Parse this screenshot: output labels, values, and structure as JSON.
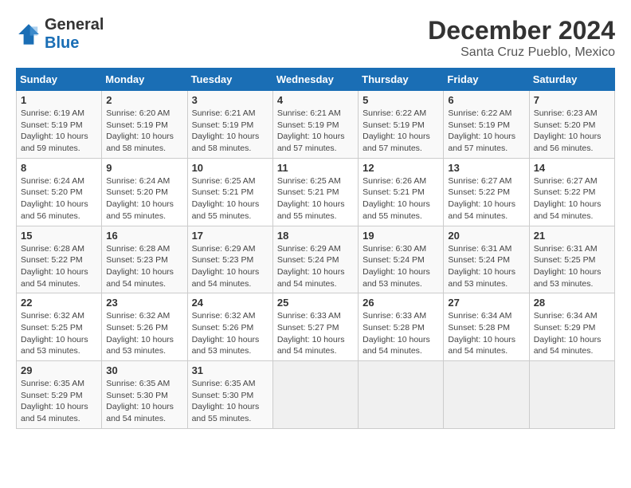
{
  "logo": {
    "line1": "General",
    "line2": "Blue"
  },
  "title": "December 2024",
  "location": "Santa Cruz Pueblo, Mexico",
  "headers": [
    "Sunday",
    "Monday",
    "Tuesday",
    "Wednesday",
    "Thursday",
    "Friday",
    "Saturday"
  ],
  "weeks": [
    [
      {
        "day": "1",
        "info": "Sunrise: 6:19 AM\nSunset: 5:19 PM\nDaylight: 10 hours\nand 59 minutes."
      },
      {
        "day": "2",
        "info": "Sunrise: 6:20 AM\nSunset: 5:19 PM\nDaylight: 10 hours\nand 58 minutes."
      },
      {
        "day": "3",
        "info": "Sunrise: 6:21 AM\nSunset: 5:19 PM\nDaylight: 10 hours\nand 58 minutes."
      },
      {
        "day": "4",
        "info": "Sunrise: 6:21 AM\nSunset: 5:19 PM\nDaylight: 10 hours\nand 57 minutes."
      },
      {
        "day": "5",
        "info": "Sunrise: 6:22 AM\nSunset: 5:19 PM\nDaylight: 10 hours\nand 57 minutes."
      },
      {
        "day": "6",
        "info": "Sunrise: 6:22 AM\nSunset: 5:19 PM\nDaylight: 10 hours\nand 57 minutes."
      },
      {
        "day": "7",
        "info": "Sunrise: 6:23 AM\nSunset: 5:20 PM\nDaylight: 10 hours\nand 56 minutes."
      }
    ],
    [
      {
        "day": "8",
        "info": "Sunrise: 6:24 AM\nSunset: 5:20 PM\nDaylight: 10 hours\nand 56 minutes."
      },
      {
        "day": "9",
        "info": "Sunrise: 6:24 AM\nSunset: 5:20 PM\nDaylight: 10 hours\nand 55 minutes."
      },
      {
        "day": "10",
        "info": "Sunrise: 6:25 AM\nSunset: 5:21 PM\nDaylight: 10 hours\nand 55 minutes."
      },
      {
        "day": "11",
        "info": "Sunrise: 6:25 AM\nSunset: 5:21 PM\nDaylight: 10 hours\nand 55 minutes."
      },
      {
        "day": "12",
        "info": "Sunrise: 6:26 AM\nSunset: 5:21 PM\nDaylight: 10 hours\nand 55 minutes."
      },
      {
        "day": "13",
        "info": "Sunrise: 6:27 AM\nSunset: 5:22 PM\nDaylight: 10 hours\nand 54 minutes."
      },
      {
        "day": "14",
        "info": "Sunrise: 6:27 AM\nSunset: 5:22 PM\nDaylight: 10 hours\nand 54 minutes."
      }
    ],
    [
      {
        "day": "15",
        "info": "Sunrise: 6:28 AM\nSunset: 5:22 PM\nDaylight: 10 hours\nand 54 minutes."
      },
      {
        "day": "16",
        "info": "Sunrise: 6:28 AM\nSunset: 5:23 PM\nDaylight: 10 hours\nand 54 minutes."
      },
      {
        "day": "17",
        "info": "Sunrise: 6:29 AM\nSunset: 5:23 PM\nDaylight: 10 hours\nand 54 minutes."
      },
      {
        "day": "18",
        "info": "Sunrise: 6:29 AM\nSunset: 5:24 PM\nDaylight: 10 hours\nand 54 minutes."
      },
      {
        "day": "19",
        "info": "Sunrise: 6:30 AM\nSunset: 5:24 PM\nDaylight: 10 hours\nand 53 minutes."
      },
      {
        "day": "20",
        "info": "Sunrise: 6:31 AM\nSunset: 5:24 PM\nDaylight: 10 hours\nand 53 minutes."
      },
      {
        "day": "21",
        "info": "Sunrise: 6:31 AM\nSunset: 5:25 PM\nDaylight: 10 hours\nand 53 minutes."
      }
    ],
    [
      {
        "day": "22",
        "info": "Sunrise: 6:32 AM\nSunset: 5:25 PM\nDaylight: 10 hours\nand 53 minutes."
      },
      {
        "day": "23",
        "info": "Sunrise: 6:32 AM\nSunset: 5:26 PM\nDaylight: 10 hours\nand 53 minutes."
      },
      {
        "day": "24",
        "info": "Sunrise: 6:32 AM\nSunset: 5:26 PM\nDaylight: 10 hours\nand 53 minutes."
      },
      {
        "day": "25",
        "info": "Sunrise: 6:33 AM\nSunset: 5:27 PM\nDaylight: 10 hours\nand 54 minutes."
      },
      {
        "day": "26",
        "info": "Sunrise: 6:33 AM\nSunset: 5:28 PM\nDaylight: 10 hours\nand 54 minutes."
      },
      {
        "day": "27",
        "info": "Sunrise: 6:34 AM\nSunset: 5:28 PM\nDaylight: 10 hours\nand 54 minutes."
      },
      {
        "day": "28",
        "info": "Sunrise: 6:34 AM\nSunset: 5:29 PM\nDaylight: 10 hours\nand 54 minutes."
      }
    ],
    [
      {
        "day": "29",
        "info": "Sunrise: 6:35 AM\nSunset: 5:29 PM\nDaylight: 10 hours\nand 54 minutes."
      },
      {
        "day": "30",
        "info": "Sunrise: 6:35 AM\nSunset: 5:30 PM\nDaylight: 10 hours\nand 54 minutes."
      },
      {
        "day": "31",
        "info": "Sunrise: 6:35 AM\nSunset: 5:30 PM\nDaylight: 10 hours\nand 55 minutes."
      },
      {
        "day": "",
        "info": ""
      },
      {
        "day": "",
        "info": ""
      },
      {
        "day": "",
        "info": ""
      },
      {
        "day": "",
        "info": ""
      }
    ]
  ]
}
